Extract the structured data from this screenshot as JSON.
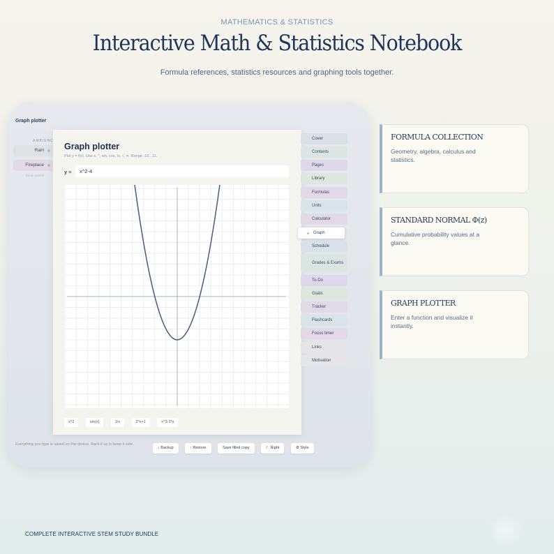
{
  "header": {
    "eyebrow": "MATHEMATICS & STATISTICS",
    "title": "Interactive Math & Statistics Notebook",
    "subtitle": "Formula references, statistics resources and graphing tools together."
  },
  "device": {
    "window_title": "Graph plotter",
    "ambience": {
      "label": "AMBIENCE",
      "items": [
        "Rain",
        "Fireplace"
      ],
      "faint_text": "Zoom rainfall"
    },
    "plotter": {
      "title": "Graph plotter",
      "help": "Plot y = f(x). Use x, ^, sin, cos, ln, √, π. Range -10...11.",
      "y_label": "y =",
      "function_value": "x^2-4",
      "presets": [
        "x^2",
        "sin(x)",
        "1/x",
        "2*x+1",
        "x^3-3*x"
      ]
    },
    "tabs": [
      {
        "label": "Cover",
        "color": "#d8e0e8"
      },
      {
        "label": "Contents",
        "color": "#dbe6e3"
      },
      {
        "label": "Pages",
        "color": "#ddd9ea"
      },
      {
        "label": "Library",
        "color": "#dde7dd"
      },
      {
        "label": "Formulas",
        "color": "#e2d9e6"
      },
      {
        "label": "Units",
        "color": "#d9e4ea"
      },
      {
        "label": "Calculator",
        "color": "#e2d9e6"
      },
      {
        "label": "Graph",
        "color": "#ffffff",
        "active": true
      },
      {
        "label": "Schedule",
        "color": "#d8e0e8"
      },
      {
        "label": "Grades & Exams",
        "color": "#dbe6e3"
      },
      {
        "label": "To-Do",
        "color": "#ddd9ea"
      },
      {
        "label": "Goals",
        "color": "#dde7dd"
      },
      {
        "label": "Tracker",
        "color": "#e2d9e6"
      },
      {
        "label": "Flashcards",
        "color": "#d9e4ea"
      },
      {
        "label": "Focus timer",
        "color": "#e2d9e6"
      },
      {
        "label": "Links",
        "color": "#e6e6e8"
      },
      {
        "label": "Motivation",
        "color": "#e6e6e8"
      }
    ],
    "footer": {
      "note": "Everything you type is saved on this device. Back it up to keep it safe.",
      "buttons": [
        "↓ Backup",
        "↑ Restore",
        "Save filled copy",
        "☾ Night",
        "⚙ Style"
      ]
    }
  },
  "cards": [
    {
      "title": "FORMULA COLLECTION",
      "desc": "Geometry, algebra, calculus and statistics."
    },
    {
      "title": "STANDARD NORMAL Φ(z)",
      "desc": "Cumulative probability values at a glance."
    },
    {
      "title": "GRAPH PLOTTER",
      "desc": "Enter a function and visualize it instantly."
    }
  ],
  "bottom_tag": "COMPLETE INTERACTIVE STEM STUDY BUNDLE",
  "colors": {
    "curve": "#4f6580",
    "axis": "#a6b0bc",
    "grid": "#eceef0",
    "card_accent": "#9fb3c8"
  }
}
